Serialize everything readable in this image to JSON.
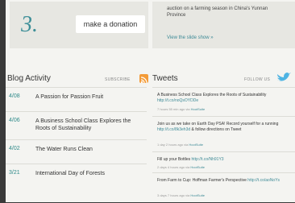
{
  "donation": {
    "step": "3.",
    "button_label": "make a donation"
  },
  "feature": {
    "text": "auction on a farming season in China's Yunnan Province",
    "link": "View the slide show »"
  },
  "blog": {
    "title": "Blog Activity",
    "subscribe_label": "SUBSCRIBE",
    "posts": [
      {
        "date": "4/08",
        "title": "A Passion for Passion Fruit"
      },
      {
        "date": "4/06",
        "title": "A Business School Class Explores the Roots of Sustainability"
      },
      {
        "date": "4/02",
        "title": "The Water Runs Clean"
      },
      {
        "date": "3/21",
        "title": "International Day of Forests"
      }
    ]
  },
  "tweets": {
    "title": "Tweets",
    "follow_label": "FOLLOW US",
    "items": [
      {
        "text": "A Business School Class Explores the Roots of Sustainability",
        "link": "http://t.co/noQsOYDDe",
        "time": "7 hours 55 min ago",
        "via": "via",
        "handle": "HootSuite"
      },
      {
        "text": "Join us as we take on Earth Day PSA! Record yourself for a running",
        "link": "http://t.co/8k3eh3d",
        "extra": "& follow directions on Tweet",
        "time": "1 day 2 hours ago",
        "via": "via",
        "handle": "HootSuite"
      },
      {
        "text": "Fill up your Bottles",
        "link": "http://t.co/Nh91Y3",
        "time": "2 days 4 hours ago",
        "via": "via",
        "handle": "HootSuite"
      },
      {
        "text": "From Farm to Cup: Hoffman Farmer's Perspective",
        "link": "http://t.co/aoNoYs",
        "time": "3 days 7 hours ago",
        "via": "via",
        "handle": "HootSuite"
      }
    ]
  }
}
